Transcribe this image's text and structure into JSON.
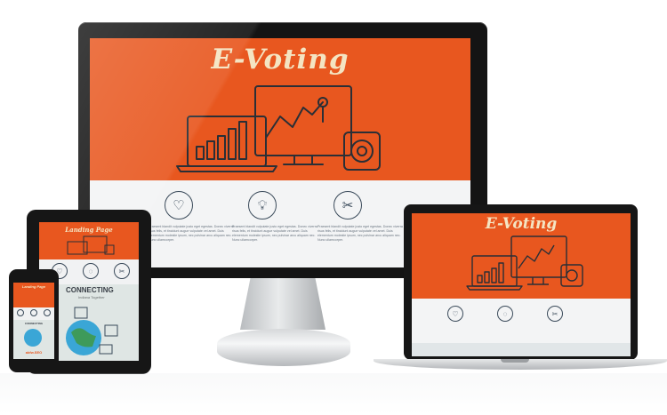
{
  "brand": {
    "orange": "#e8571f",
    "navy": "#3a4a5a",
    "cream": "#f4e4c2"
  },
  "monitor": {
    "title": "E-Voting",
    "features": [
      {
        "icon": "heart-icon",
        "text": "Praesent blandit vulputate justo eget egestas. Donec viverra risus felis, et tincidunt augue vulputate vel amet. Duis elementum molestie ipsum, nec pulvinar arcu aliquam nec. Nunc ullamcorper."
      },
      {
        "icon": "lightbulb-icon",
        "text": "Praesent blandit vulputate justo eget egestas. Donec viverra risus felis, et tincidunt augue vulputate vel amet. Duis elementum molestie ipsum, nec pulvinar arcu aliquam nec. Nunc ullamcorper."
      },
      {
        "icon": "tools-icon",
        "text": "Praesent blandit vulputate justo eget egestas. Donec viverra risus felis, et tincidunt augue vulputate vel amet. Duis elementum molestie ipsum, nec pulvinar arcu aliquam nec. Nunc ullamcorper."
      }
    ]
  },
  "tablet": {
    "title": "Landing Page",
    "connecting_title": "CONNECTING",
    "connecting_sub": "Indiana Together"
  },
  "phone": {
    "title": "Landing Page",
    "section_title": "CONNECTING",
    "brand": "abfw.SEO"
  },
  "laptop": {
    "title": "E-Voting"
  }
}
